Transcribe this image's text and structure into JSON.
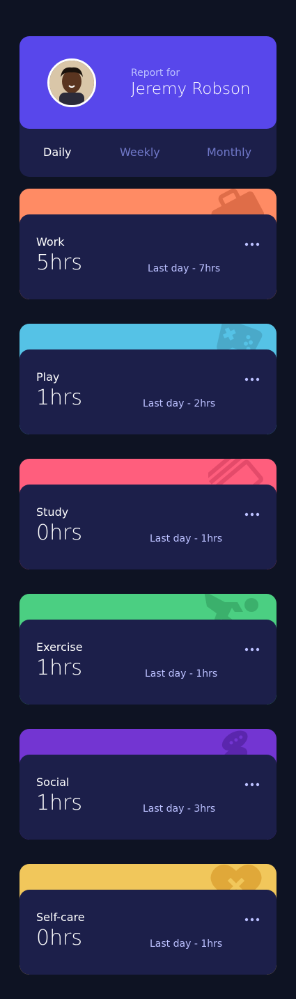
{
  "profile": {
    "report_label": "Report for",
    "name": "Jeremy Robson",
    "avatar": "user-avatar-photo"
  },
  "periods": [
    {
      "label": "Daily",
      "active": true
    },
    {
      "label": "Weekly",
      "active": false
    },
    {
      "label": "Monthly",
      "active": false
    }
  ],
  "cards": [
    {
      "title": "Work",
      "current": "5hrs",
      "previous": "Last day - 7hrs",
      "color": "#ff8b64",
      "icon": "briefcase-icon"
    },
    {
      "title": "Play",
      "current": "1hrs",
      "previous": "Last day - 2hrs",
      "color": "#55c2e6",
      "icon": "game-controller-icon"
    },
    {
      "title": "Study",
      "current": "0hrs",
      "previous": "Last day - 1hrs",
      "color": "#ff5e7d",
      "icon": "books-icon"
    },
    {
      "title": "Exercise",
      "current": "1hrs",
      "previous": "Last day - 1hrs",
      "color": "#4bcf82",
      "icon": "running-person-icon"
    },
    {
      "title": "Social",
      "current": "1hrs",
      "previous": "Last day - 3hrs",
      "color": "#7335d2",
      "icon": "chat-bubbles-icon"
    },
    {
      "title": "Self-care",
      "current": "0hrs",
      "previous": "Last day - 1hrs",
      "color": "#f1c75b",
      "icon": "heart-icon"
    }
  ],
  "colors": {
    "background": "#0e1323",
    "card": "#1c1f4a",
    "accent": "#5847eb",
    "muted": "#bbc0ff"
  }
}
